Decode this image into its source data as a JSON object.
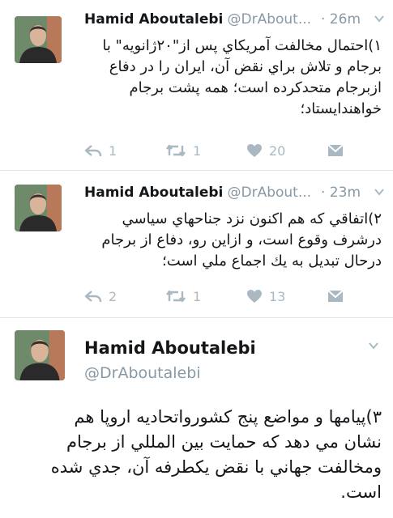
{
  "tweets": [
    {
      "name": "Hamid Aboutalebi",
      "handle": "@DrAbout...",
      "time": "· 26m",
      "text_lines": [
        "۱)احتمال مخالفت آمريكاي پس از\"۲۰ژانويه\" با",
        "برجام و تلاش براي نقض آن، ايران را در دفاع",
        "ازبرجام متحدكرده است؛ همه پشت برجام",
        "خواهندايستاد؛"
      ],
      "replies": "1",
      "retweets": "1",
      "likes": "20"
    },
    {
      "name": "Hamid Aboutalebi",
      "handle": "@DrAbout...",
      "time": "· 23m",
      "text_lines": [
        "۲)اتفاقي كه هم اكنون نزد جناحهاي سياسي",
        "درشرف وقوع است، و ازاين رو، دفاع از برجام",
        "درحال تبديل به يك اجماع ملي است؛"
      ],
      "replies": "2",
      "retweets": "1",
      "likes": "13"
    }
  ],
  "expanded": {
    "name": "Hamid Aboutalebi",
    "handle": "@DrAboutalebi",
    "text_lines": [
      "۳)پيامها و مواضع پنج كشورواتحاديه اروپا هم",
      "نشان مي دهد كه حمايت بين المللي از برجام",
      "ومخالفت جهاني با نقض يكطرفه آن، جدي شده",
      "است."
    ]
  },
  "colors": {
    "muted": "#8899a6",
    "icon": "#aab8c2",
    "divider": "#e1e8ed"
  },
  "icons": [
    "reply-icon",
    "retweet-icon",
    "like-icon",
    "dm-icon",
    "chevron-down-icon"
  ]
}
